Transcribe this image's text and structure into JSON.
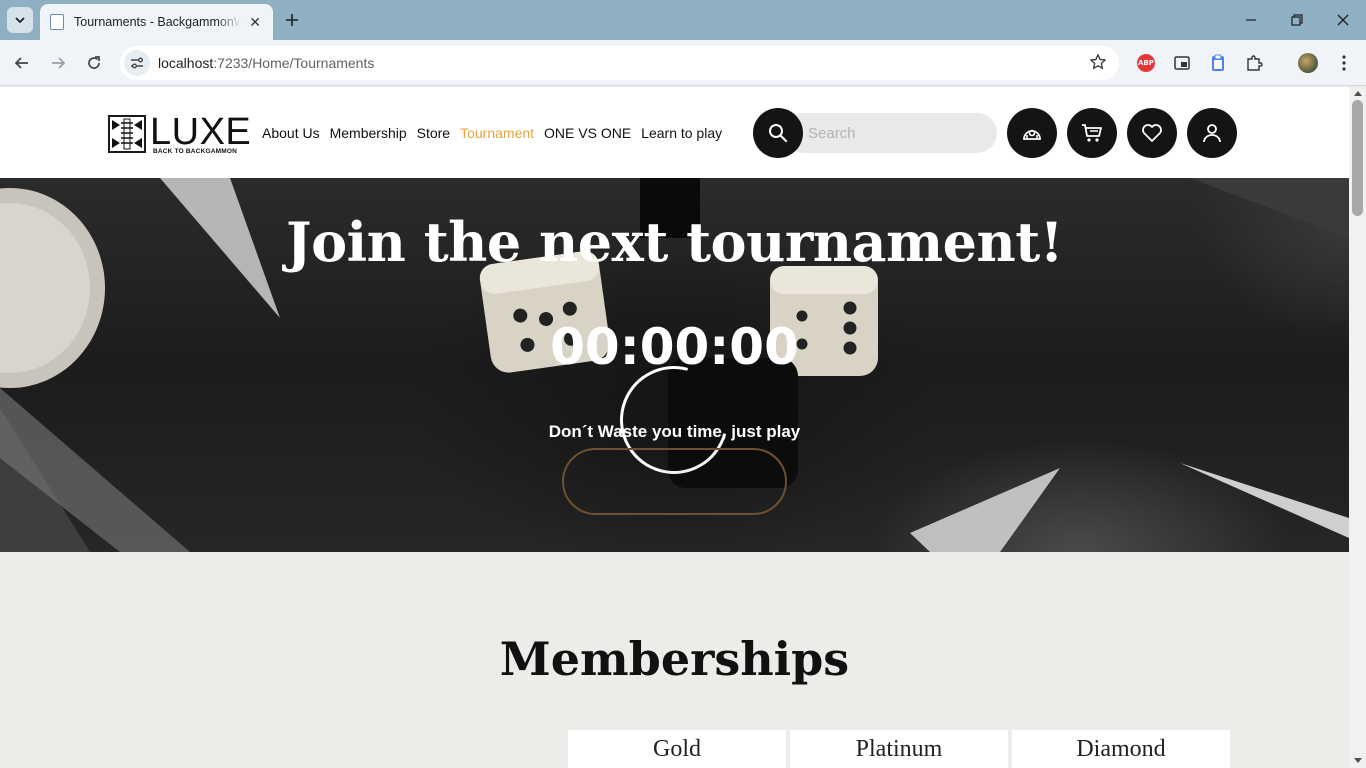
{
  "browser": {
    "tab_title": "Tournaments - BackgammonWorld",
    "url_host": "localhost",
    "url_path": ":7233/Home/Tournaments"
  },
  "site": {
    "logo_text": "LUXE",
    "logo_subtitle": "BACK TO BACKGAMMON",
    "nav": [
      "About Us",
      "Membership",
      "Store",
      "Tournament",
      "ONE VS ONE",
      "Learn to play"
    ],
    "active_nav": "Tournament",
    "accent_color": "#e8a33d",
    "search_placeholder": "Search"
  },
  "hero": {
    "title": "Join the next tournament!",
    "countdown": "00:00:00",
    "tagline": "Don´t Waste you time, just play",
    "button_label": ""
  },
  "memberships": {
    "title": "Memberships",
    "plans": [
      "Gold",
      "Platinum",
      "Diamond"
    ]
  }
}
